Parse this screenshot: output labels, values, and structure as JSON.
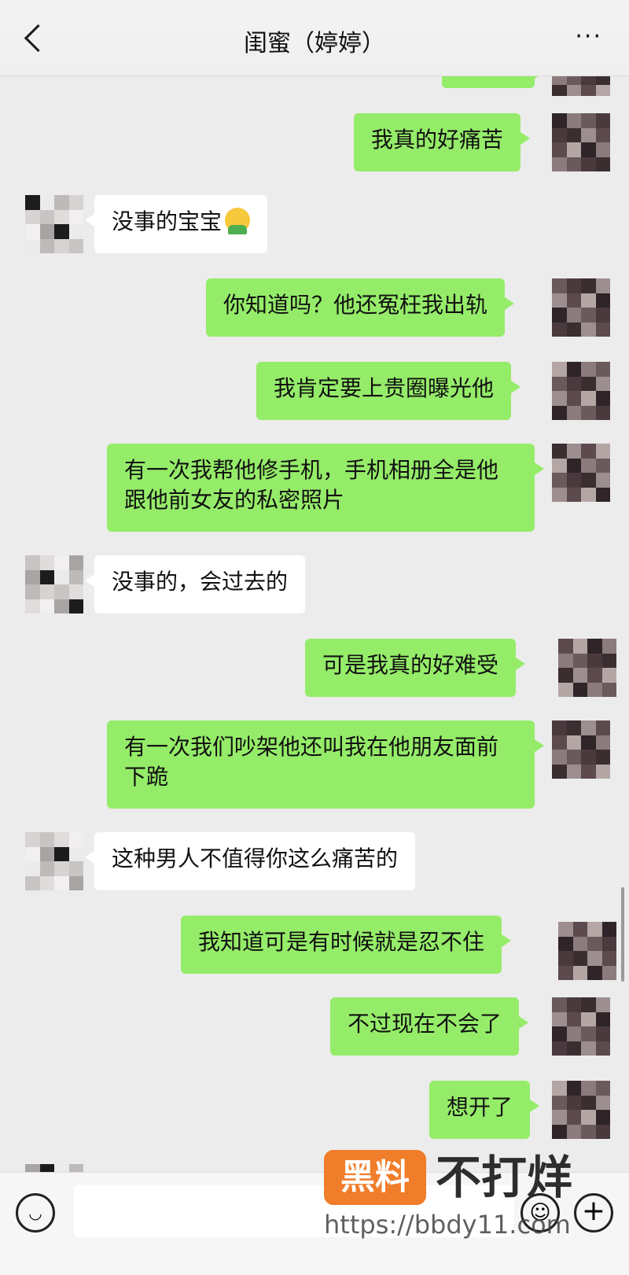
{
  "header": {
    "back_icon": "chevron-left-icon",
    "title": "闺蜜（婷婷）",
    "more_icon": "more-icon",
    "more_label": "···"
  },
  "messages": [
    {
      "side": "me",
      "text": ""
    },
    {
      "side": "me",
      "text": "我真的好痛苦"
    },
    {
      "side": "them",
      "text": "没事的宝宝",
      "emoji": "person-emoji"
    },
    {
      "side": "me",
      "text": "你知道吗？他还冤枉我出轨"
    },
    {
      "side": "me",
      "text": "我肯定要上贵圈曝光他"
    },
    {
      "side": "me",
      "text": "有一次我帮他修手机，手机相册全是他跟他前女友的私密照片"
    },
    {
      "side": "them",
      "text": "没事的，会过去的"
    },
    {
      "side": "me",
      "text": "可是我真的好难受"
    },
    {
      "side": "me",
      "text": "有一次我们吵架他还叫我在他朋友面前下跪"
    },
    {
      "side": "them",
      "text": "这种男人不值得你这么痛苦的"
    },
    {
      "side": "me",
      "text": "我知道可是有时候就是忍不住"
    },
    {
      "side": "me",
      "text": "不过现在不会了"
    },
    {
      "side": "me",
      "text": "想开了"
    }
  ],
  "bottombar": {
    "voice_icon": "voice-icon",
    "input_value": "",
    "emoji_icon": "emoji-icon",
    "plus_icon": "plus-icon"
  },
  "watermark": {
    "badge": "黑料",
    "text": "不打烊",
    "url": "https://bbdy11.com"
  },
  "colors": {
    "me_bubble": "#95ec69",
    "them_bubble": "#ffffff",
    "background": "#ececec",
    "watermark_orange": "#f07d2a"
  }
}
